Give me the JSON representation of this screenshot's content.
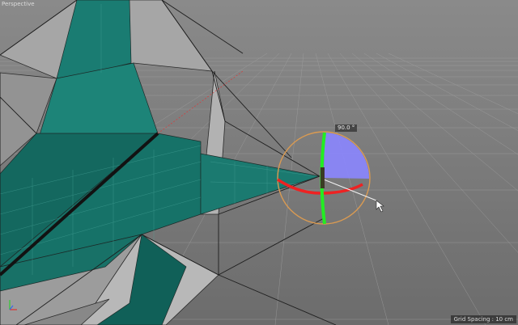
{
  "viewport": {
    "view_name": "Perspective",
    "grid_spacing_text": "Grid Spacing : 10 cm"
  },
  "rotate_tool": {
    "angle_readout": "90.0 °",
    "angle_degrees": 90
  },
  "colors": {
    "background": "#8e8e8e",
    "mesh_teal": "#18796f",
    "mesh_gray": "#9a9a9a",
    "gizmo_ring": "#d99a52",
    "x_axis_ring": "#ee2222",
    "y_axis_ring": "#22ee22",
    "sweep_fill": "#8b86ff"
  },
  "icons": {
    "world_axis": "axis-gizmo-icon",
    "cursor": "mouse-pointer-icon"
  }
}
